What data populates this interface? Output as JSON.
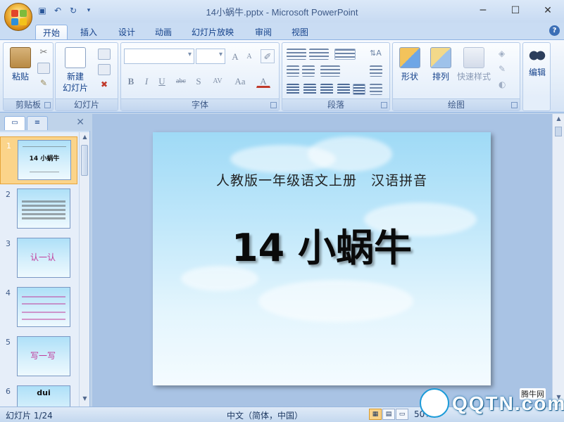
{
  "window": {
    "title": "14小蜗牛.pptx - Microsoft PowerPoint"
  },
  "quick_access": {
    "icons": [
      "save-icon",
      "undo-icon",
      "redo-icon",
      "customize-icon"
    ]
  },
  "window_controls": {
    "minimize": "─",
    "maximize": "☐",
    "close": "✕"
  },
  "tabs": [
    {
      "label": "开始",
      "active": true
    },
    {
      "label": "插入"
    },
    {
      "label": "设计"
    },
    {
      "label": "动画"
    },
    {
      "label": "幻灯片放映"
    },
    {
      "label": "审阅"
    },
    {
      "label": "视图"
    }
  ],
  "help": "?",
  "ribbon": {
    "clipboard": {
      "label": "剪贴板",
      "paste": "粘贴"
    },
    "slides": {
      "label": "幻灯片",
      "new_slide_line1": "新建",
      "new_slide_line2": "幻灯片"
    },
    "font": {
      "label": "字体",
      "grow": "A",
      "shrink": "A",
      "bold": "B",
      "italic": "I",
      "underline": "U",
      "strike": "abc",
      "shadow": "S",
      "spacing": "AV",
      "case": "Aa",
      "color": "A"
    },
    "paragraph": {
      "label": "段落"
    },
    "drawing": {
      "label": "绘图",
      "shapes": "形状",
      "arrange": "排列",
      "quick_styles": "快速样式"
    },
    "editing": {
      "label": "编辑"
    }
  },
  "thumbnails": [
    {
      "num": "1",
      "title": "14 小蜗牛",
      "selected": true
    },
    {
      "num": "2",
      "title": ""
    },
    {
      "num": "3",
      "title": "认一认"
    },
    {
      "num": "4",
      "title": ""
    },
    {
      "num": "5",
      "title": "写一写"
    },
    {
      "num": "6",
      "title": "dui"
    }
  ],
  "slide": {
    "subtitle": "人教版一年级语文上册　汉语拼音",
    "title": "14 小蜗牛"
  },
  "status": {
    "slide_info": "幻灯片 1/24",
    "language": "中文（简体，中国）",
    "zoom": "50%"
  },
  "watermark": {
    "text": "QQTN.com",
    "site": "腾牛网"
  }
}
